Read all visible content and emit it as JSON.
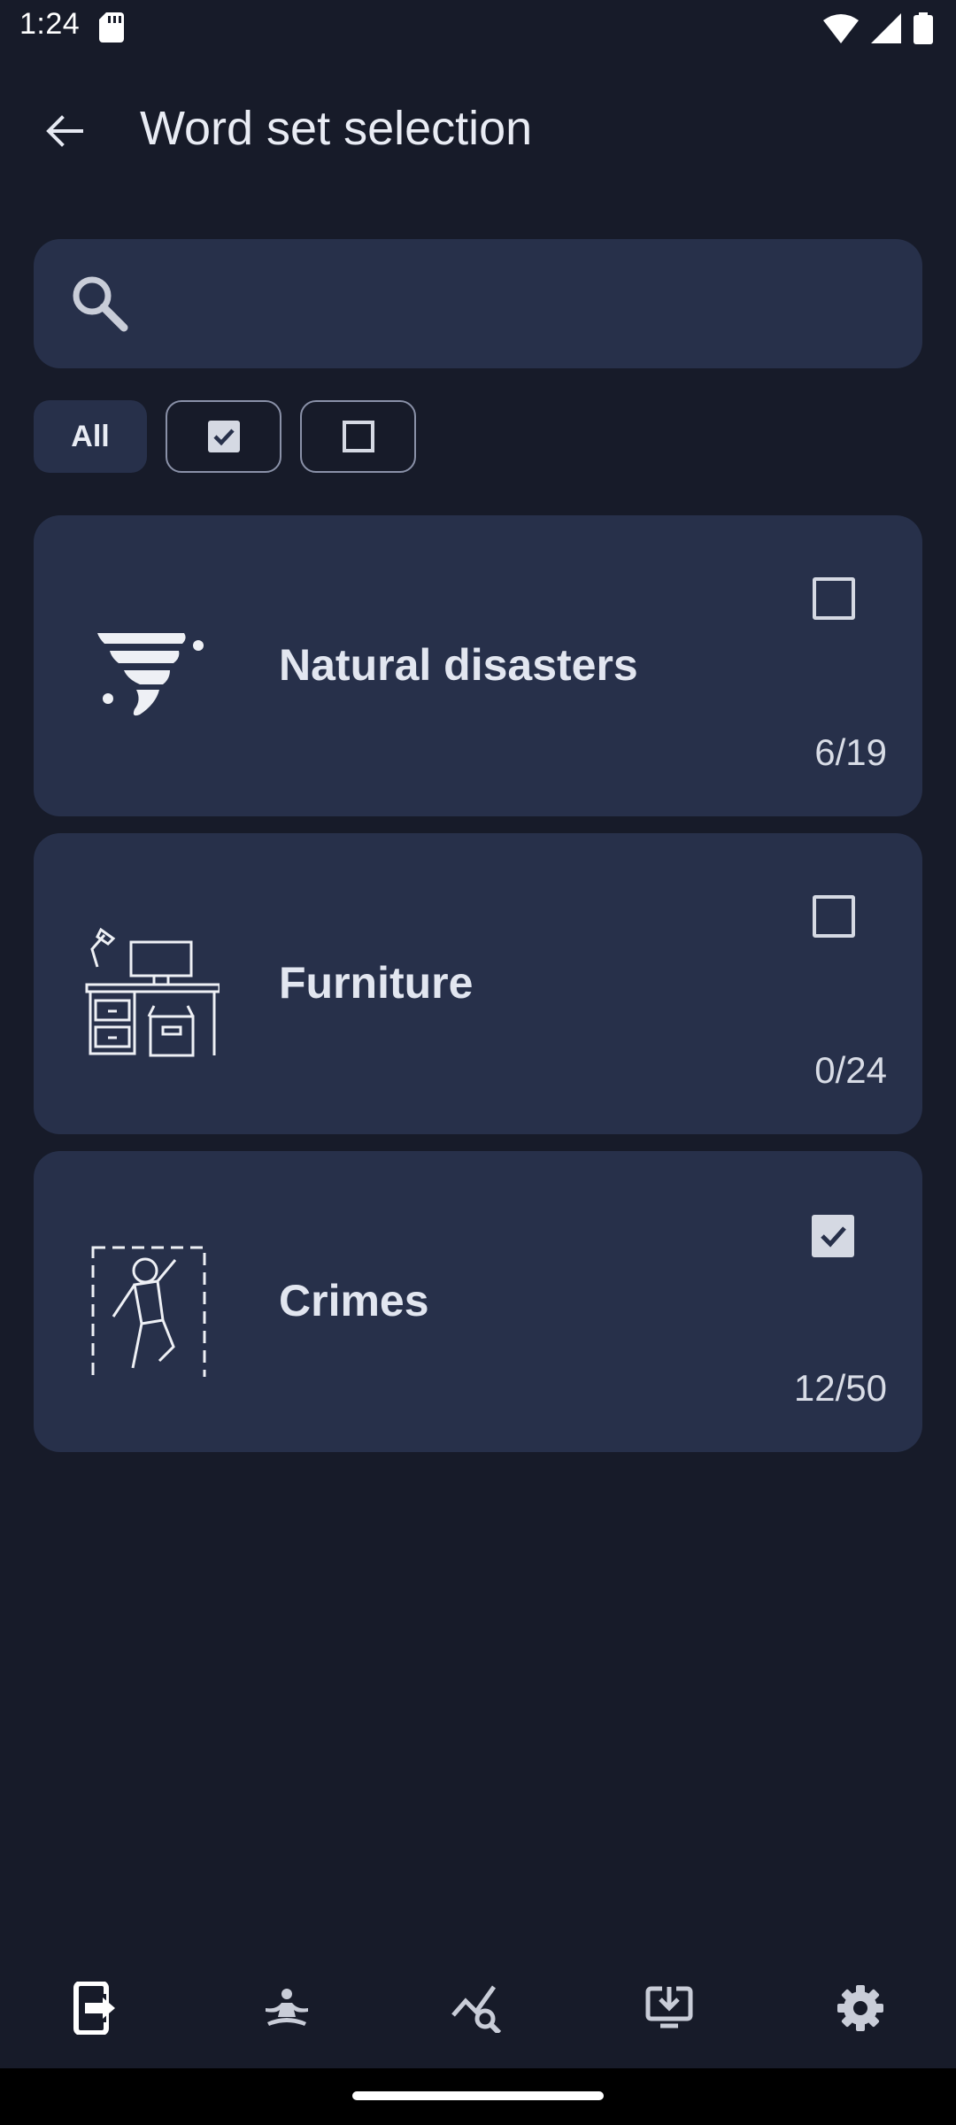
{
  "status_bar": {
    "time": "1:24"
  },
  "app_bar": {
    "title": "Word set selection"
  },
  "search": {
    "placeholder": ""
  },
  "filters": {
    "all_label": "All"
  },
  "word_sets": [
    {
      "name": "Natural disasters",
      "count": "6/19",
      "checked": false,
      "icon": "tornado-icon"
    },
    {
      "name": "Furniture",
      "count": "0/24",
      "checked": false,
      "icon": "desk-icon"
    },
    {
      "name": "Crimes",
      "count": "12/50",
      "checked": true,
      "icon": "crime-scene-icon"
    }
  ],
  "bottom_nav": [
    {
      "icon": "word-sets-icon",
      "active": true
    },
    {
      "icon": "practice-icon",
      "active": false
    },
    {
      "icon": "statistics-icon",
      "active": false
    },
    {
      "icon": "download-icon",
      "active": false
    },
    {
      "icon": "settings-icon",
      "active": false
    }
  ],
  "colors": {
    "background": "#171b29",
    "surface": "#27304a",
    "text": "#e6e9f2",
    "outline": "#8a91a8"
  }
}
